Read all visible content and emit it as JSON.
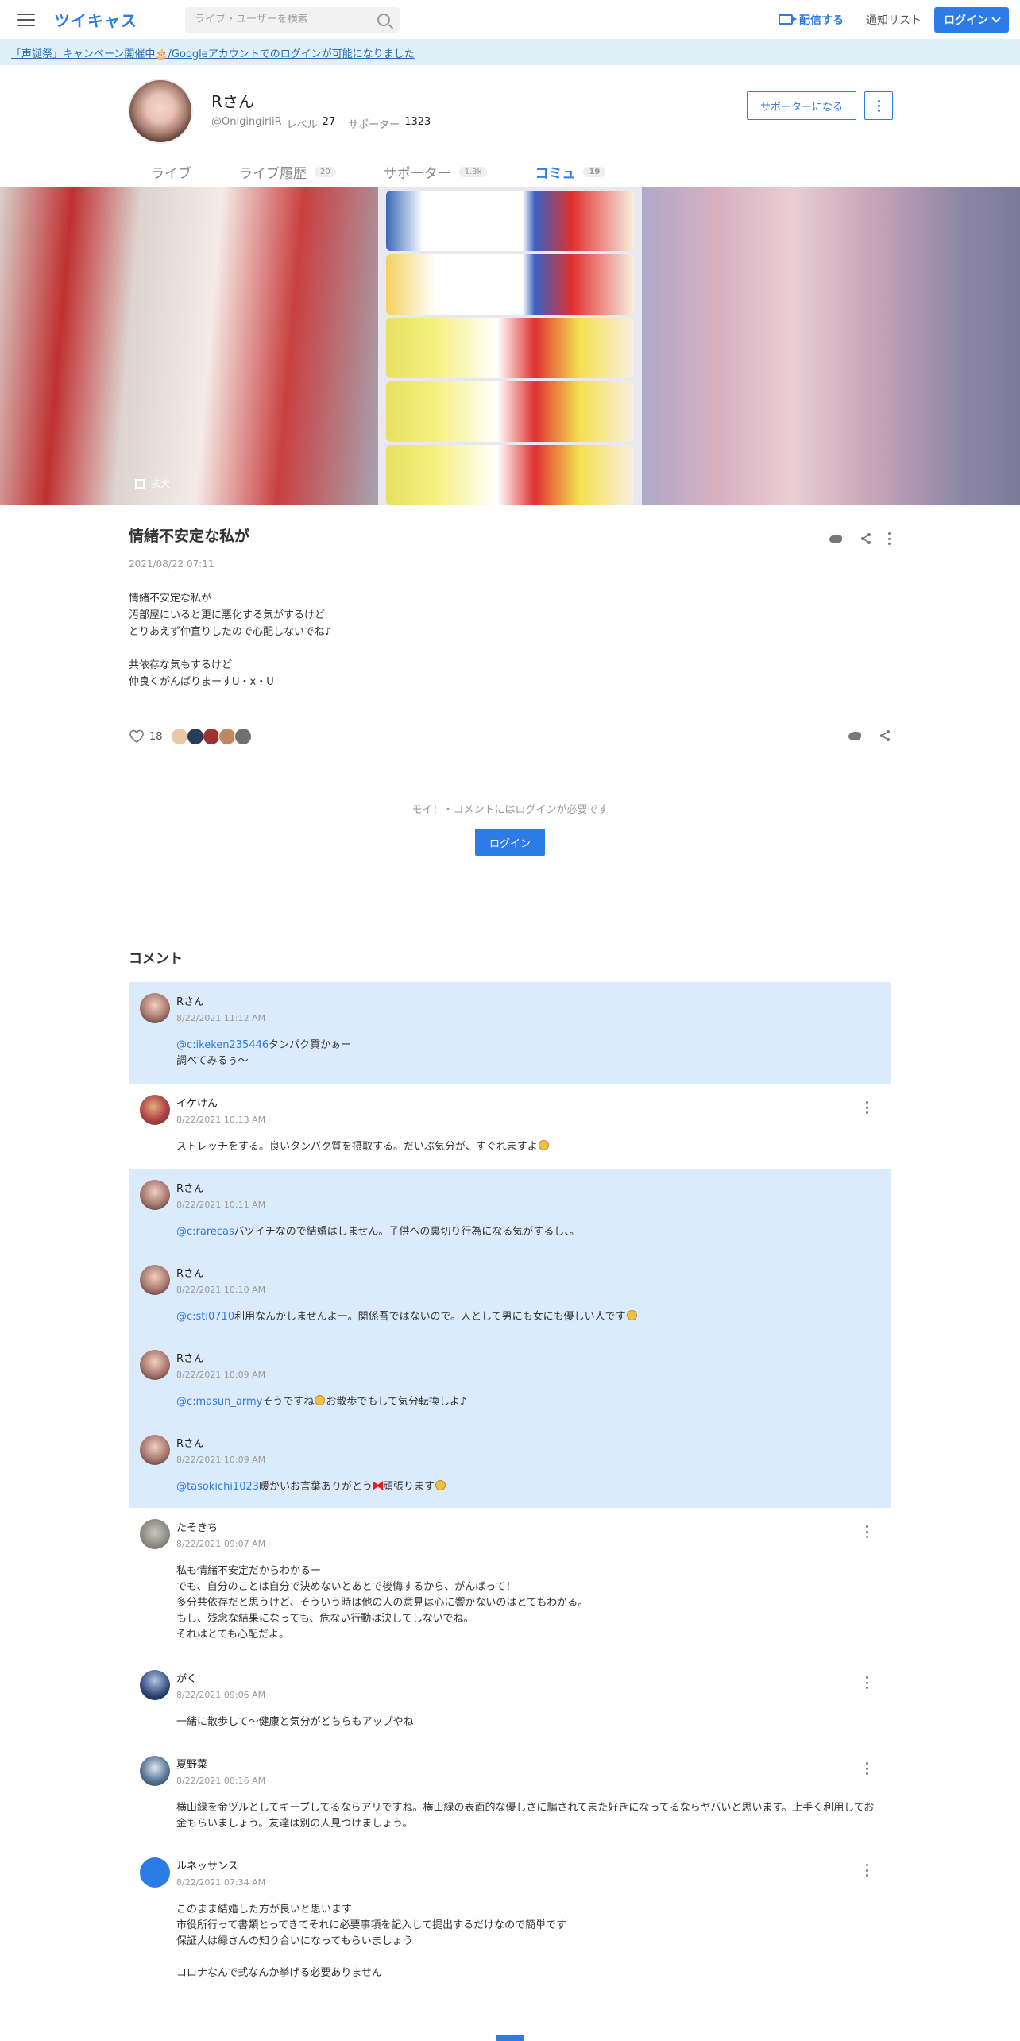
{
  "header": {
    "logo": "ツイキャス",
    "search_placeholder": "ライブ・ユーザーを検索",
    "broadcast": "配信する",
    "notify": "通知リスト",
    "login": "ログイン"
  },
  "banner": "「声誕祭」キャンペーン開催中🎂/Googleアカウントでのログインが可能になりました",
  "profile": {
    "name": "Rさん",
    "handle": "@OnigingiriiR",
    "level_label": "レベル",
    "level": "27",
    "supporter_label": "サポーター",
    "supporters": "1323",
    "support_button": "サポーターになる"
  },
  "tabs": [
    {
      "label": "ライブ",
      "count": ""
    },
    {
      "label": "ライブ履歴",
      "count": "20"
    },
    {
      "label": "サポーター",
      "count": "1.3k"
    },
    {
      "label": "コミュ",
      "count": "19"
    }
  ],
  "image": {
    "expand": "拡大"
  },
  "post": {
    "title": "情緒不安定な私が",
    "date": "2021/08/22 07:11",
    "body": "情緒不安定な私が\n汚部屋にいると更に悪化する気がするけど\nとりあえず仲直りしたので心配しないでね♪\n\n共依存な気もするけど\n仲良くがんばりまーすU・x・U",
    "likes": "18"
  },
  "login_notice": "モイ！・コメントにはログインが必要です",
  "login_center": "ログイン",
  "comments_heading": "コメント",
  "colors": {
    "accent": "#2d7be6",
    "highlight": "#dcebfc",
    "banner": "#dff0f8"
  },
  "comments": [
    {
      "name": "Rさん",
      "date": "8/22/2021 11:12 AM",
      "mention": "@c:ikeken235446",
      "text": "タンパク質かぁー\n調べてみるぅ〜"
    },
    {
      "name": "イケけん",
      "date": "8/22/2021 10:13 AM",
      "mention": "",
      "text": "ストレッチをする。良いタンパク質を摂取する。だいぶ気分が、すぐれますよ"
    },
    {
      "name": "Rさん",
      "date": "8/22/2021 10:11 AM",
      "mention": "@c:rarecas",
      "text": "バツイチなので結婚はしません。子供への裏切り行為になる気がするし、。"
    },
    {
      "name": "Rさん",
      "date": "8/22/2021 10:10 AM",
      "mention": "@c:sti0710",
      "text": "利用なんかしませんよー。関係吾ではないので。人として男にも女にも優しい人です"
    },
    {
      "name": "Rさん",
      "date": "8/22/2021 10:09 AM",
      "mention": "@c:masun_army",
      "text_a": "そうですね",
      "text_b": "お散歩でもして気分転換しよ♪"
    },
    {
      "name": "Rさん",
      "date": "8/22/2021 10:09 AM",
      "mention": "@tasokichi1023",
      "text_a": "暖かいお言葉ありがとう",
      "text_b": "頑張ります"
    },
    {
      "name": "たそきち",
      "date": "8/22/2021 09:07 AM",
      "mention": "",
      "text": "私も情緒不安定だからわかるー\nでも、自分のことは自分で決めないとあとで後悔するから、がんばって！\n多分共依存だと思うけど、そういう時は他の人の意見は心に響かないのはとてもわかる。\nもし、残念な結果になっても、危ない行動は決してしないでね。\nそれはとても心配だよ。"
    },
    {
      "name": "がく",
      "date": "8/22/2021 09:06 AM",
      "mention": "",
      "text": "一緒に散歩して〜健康と気分がどちらもアップやね"
    },
    {
      "name": "夏野菜",
      "date": "8/22/2021 08:16 AM",
      "mention": "",
      "text": "横山緑を金ヅルとしてキープしてるならアリですね。横山緑の表面的な優しさに騙されてまた好きになってるならヤバいと思います。上手く利用してお金もらいましょう。友達は別の人見つけましょう。"
    },
    {
      "name": "ルネッサンス",
      "date": "8/22/2021 07:34 AM",
      "mention": "",
      "text": "このまま結婚した方が良いと思います\n市役所行って書類とってきてそれに必要事項を記入して提出するだけなので簡単です\n保証人は緑さんの知り合いになってもらいましょう\n\nコロナなんで式なんか挙げる必要ありません"
    }
  ]
}
